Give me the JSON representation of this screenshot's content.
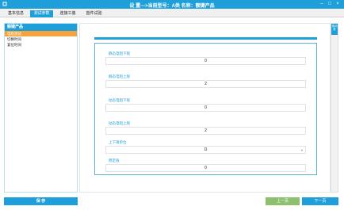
{
  "window": {
    "title": "设 置--->当前型号：A类 名称：额键产品",
    "min_glyph": "–",
    "max_glyph": "□",
    "close_glyph": "×"
  },
  "tabs": [
    {
      "label": "基本信息"
    },
    {
      "label": "测试参数"
    },
    {
      "label": "连接工装"
    },
    {
      "label": "首件试验"
    }
  ],
  "sidebar": {
    "header": "额键产品",
    "items": [
      {
        "label": "电阻测试"
      },
      {
        "label": "切换时间"
      },
      {
        "label": "复位时间"
      }
    ]
  },
  "form": {
    "fields": [
      {
        "label": "静态电阻下限",
        "value": "0"
      },
      {
        "label": "静态电阻上限",
        "value": "2"
      },
      {
        "label": "动态电阻下限",
        "value": "0"
      },
      {
        "label": "动态电阻上限",
        "value": "2"
      },
      {
        "label": "上下限单位",
        "value": "Ω"
      },
      {
        "label": "稳定值",
        "value": "0"
      }
    ]
  },
  "scroll": {
    "thumb_label": "滚动条"
  },
  "footer": {
    "save_label": "保 存",
    "prev_label": "上一页",
    "next_label": "下一页"
  }
}
